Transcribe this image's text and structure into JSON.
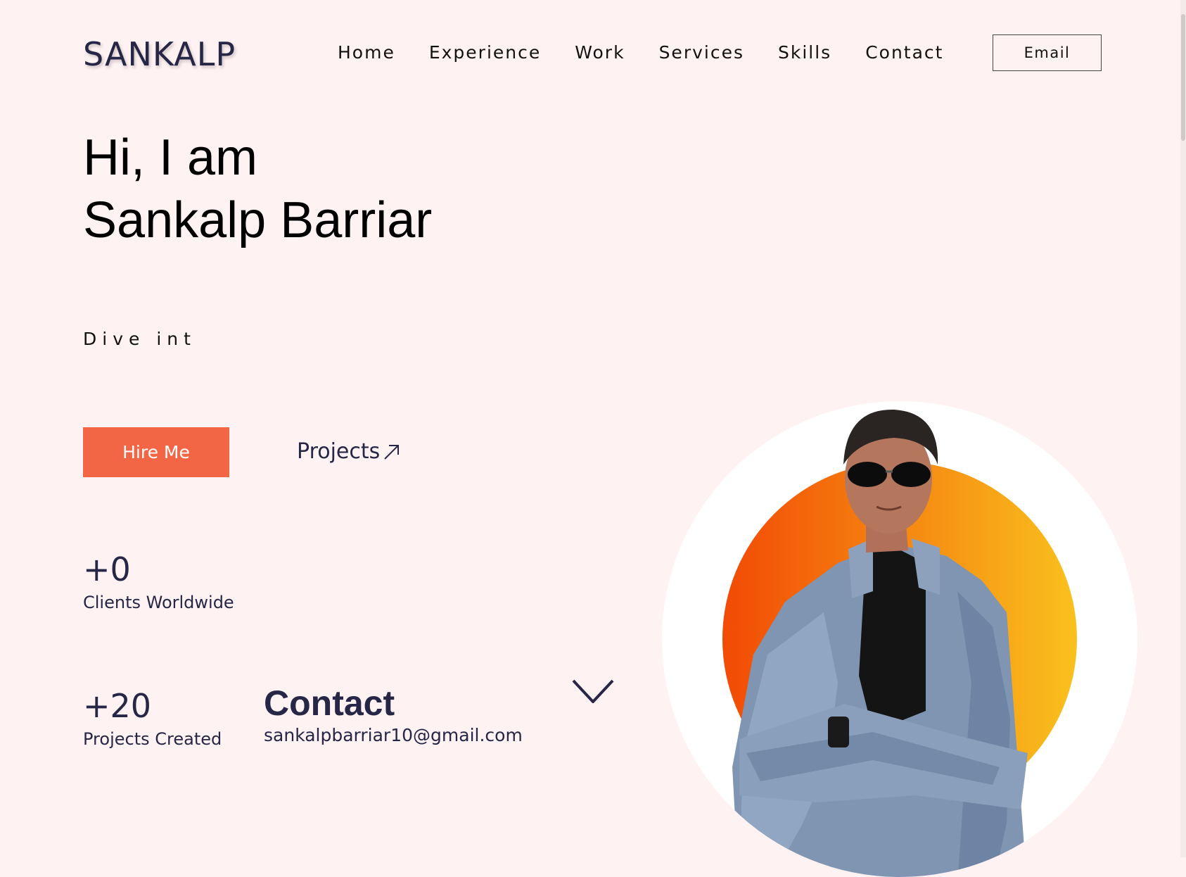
{
  "header": {
    "logo": "SANKALP",
    "nav": [
      "Home",
      "Experience",
      "Work",
      "Services",
      "Skills",
      "Contact"
    ],
    "email_button": "Email"
  },
  "hero": {
    "line1": "Hi, I am",
    "line2": "Sankalp Barriar",
    "tagline": "Dive int",
    "hire_button": "Hire Me",
    "projects_link": "Projects",
    "projects_icon": "arrow-up-right-icon"
  },
  "stats": [
    {
      "value": "+0",
      "label": "Clients Worldwide"
    },
    {
      "value": "+20",
      "label": "Projects Created"
    }
  ],
  "contact": {
    "title": "Contact",
    "email": "sankalpbarriar10@gmail.com",
    "scroll_icon": "chevron-down-icon"
  },
  "colors": {
    "background": "#fff2f2",
    "accent": "#f26545",
    "text_dark": "#262646",
    "gradient_start": "#f24a05",
    "gradient_end": "#f9c11d"
  }
}
